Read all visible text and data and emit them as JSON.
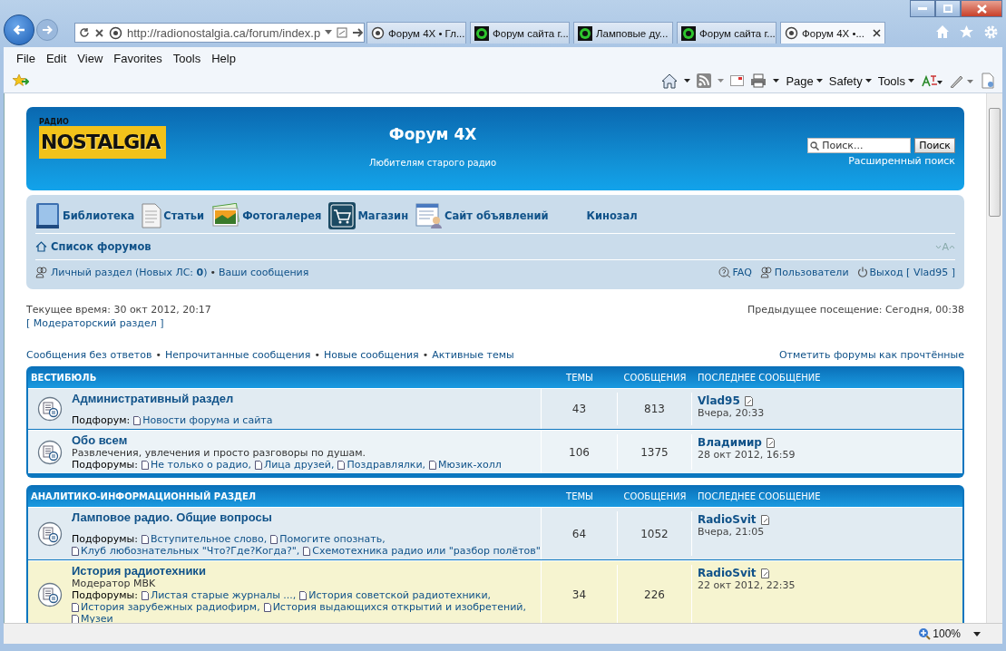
{
  "browser": {
    "address": "http://radionostalgia.ca/forum/index.p",
    "tabs": [
      {
        "title": "Форум 4X • Гл...",
        "kind": "site",
        "selected": false
      },
      {
        "title": "Форум сайта г...",
        "kind": "ring",
        "selected": false
      },
      {
        "title": "Ламповые ду...",
        "kind": "ring",
        "selected": false
      },
      {
        "title": "Форум сайта г...",
        "kind": "ring",
        "selected": false
      },
      {
        "title": "Форум 4X •...",
        "kind": "site",
        "selected": true
      }
    ],
    "menu": [
      "File",
      "Edit",
      "View",
      "Favorites",
      "Tools",
      "Help"
    ],
    "commands": [
      "Page",
      "Safety",
      "Tools"
    ],
    "zoom": "100%"
  },
  "header": {
    "logo_small": "РАДИО",
    "logo": "NOSTALGIA",
    "title": "Форум 4X",
    "subtitle": "Любителям старого радио",
    "search_placeholder": "Поиск...",
    "search_button": "Поиск",
    "advanced_search": "Расширенный поиск"
  },
  "nav": {
    "links": [
      {
        "label": "Библиотека",
        "kind": "book"
      },
      {
        "label": "Статьи",
        "kind": "page"
      },
      {
        "label": "Фотогалерея",
        "kind": "photo"
      },
      {
        "label": "Магазин",
        "kind": "cart"
      },
      {
        "label": "Сайт объявлений",
        "kind": "board"
      },
      {
        "label": "Кинозал",
        "kind": "plain"
      }
    ],
    "breadcrumb": "Список форумов",
    "font_control": "A",
    "user_links": [
      {
        "label": "Личный раздел (Новых ЛС: **0**)"
      },
      {
        "label": "Ваши сообщения"
      }
    ],
    "user_separator": "•",
    "right_links": [
      {
        "label": "FAQ",
        "kind": "help"
      },
      {
        "label": "Пользователи",
        "kind": "users"
      },
      {
        "label": "Выход [ Vlad95 ]",
        "kind": "power"
      }
    ]
  },
  "info": {
    "current_time": "Текущее время: 30 окт 2012, 20:17",
    "moderator_link": "[ Модераторский раздел ]",
    "last_visit": "Предыдущее посещение: Сегодня, 00:38"
  },
  "quick_links": {
    "links": [
      "Сообщения без ответов",
      "Непрочитанные сообщения",
      "Новые сообщения",
      "Активные темы"
    ],
    "separators": [
      "•",
      "•",
      "•"
    ],
    "mark_read": "Отметить форумы как прочтённые"
  },
  "categories": [
    {
      "name": "ВЕСТИБЮЛЬ",
      "columns": [
        "ТЕМЫ",
        "СООБЩЕНИЯ",
        "ПОСЛЕДНЕЕ СООБЩЕНИЕ"
      ],
      "forums": [
        {
          "title": "Административный раздел",
          "subforums_label": "Подфорум:",
          "subforums": [
            [
              "Новости форума и сайта"
            ]
          ],
          "topics": "43",
          "posts": "813",
          "last_author": "Vlad95",
          "last_time": "Вчера, 20:33",
          "highlighted": false
        },
        {
          "title": "Обо всем",
          "description": "Развлечения, увлечения и просто разговоры по душам.",
          "subforums_label": "Подфорумы:",
          "subforums": [
            [
              "Не только о радио,",
              "Лица друзей,",
              "Поздравлялки,",
              "Мюзик-холл"
            ]
          ],
          "topics": "106",
          "posts": "1375",
          "last_author": "Владимир",
          "last_time": "28 окт 2012, 16:59",
          "highlighted": false
        }
      ]
    },
    {
      "name": "АНАЛИТИКО-ИНФОРМАЦИОННЫЙ РАЗДЕЛ",
      "columns": [
        "ТЕМЫ",
        "СООБЩЕНИЯ",
        "ПОСЛЕДНЕЕ СООБЩЕНИЕ"
      ],
      "forums": [
        {
          "title": "Ламповое радио. Общие вопросы",
          "subforums_label": "Подфорумы:",
          "subforums": [
            [
              "Вступительное слово,",
              "Помогите опознать,"
            ],
            [
              "Клуб любознательных \"Что?Где?Когда?\",",
              "Схемотехника радио или \"разбор полётов\""
            ]
          ],
          "topics": "64",
          "posts": "1052",
          "last_author": "RadioSvit",
          "last_time": "Вчера, 21:05",
          "highlighted": false
        },
        {
          "title": "История радиотехники",
          "description": "Модератор MBK",
          "subforums_label": "Подфорумы:",
          "subforums": [
            [
              "Листая старые журналы ...,",
              "История советской радиотехники,"
            ],
            [
              "История зарубежных радиофирм,",
              "История выдающихся открытий и изобретений,"
            ],
            [
              "Музеи"
            ]
          ],
          "topics": "34",
          "posts": "226",
          "last_author": "RadioSvit",
          "last_time": "22 окт 2012, 22:35",
          "highlighted": true
        }
      ]
    }
  ]
}
